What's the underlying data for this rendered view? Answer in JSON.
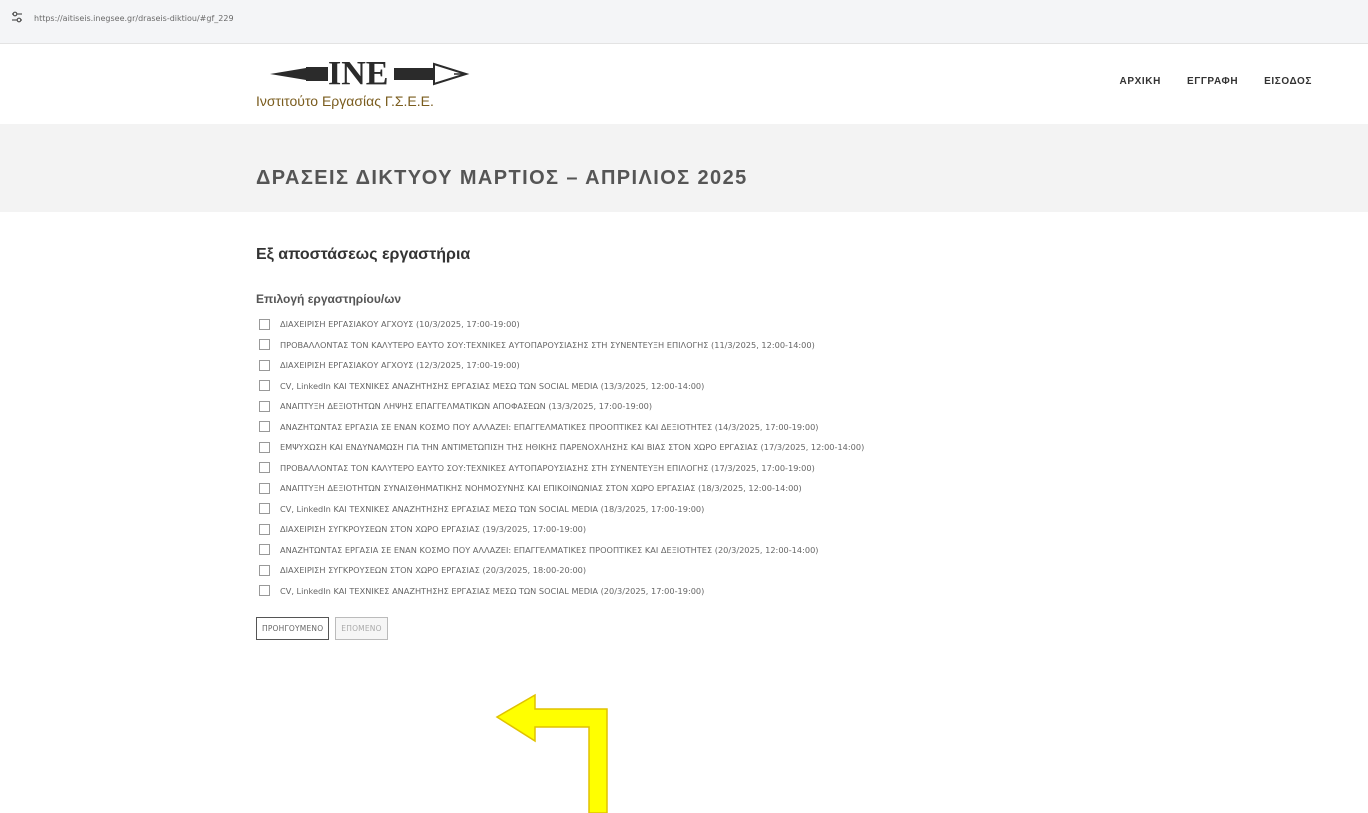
{
  "browser": {
    "url": "https://aitiseis.inegsee.gr/draseis-diktiou/#gf_229",
    "site_icon": "tune-icon"
  },
  "header": {
    "logo_text": "ΙΝΕ",
    "logo_tagline": "Ινστιτούτο Εργασίας Γ.Σ.Ε.Ε.",
    "nav": [
      {
        "label": "ΑΡΧΙΚΗ"
      },
      {
        "label": "ΕΓΓΡΑΦΗ"
      },
      {
        "label": "ΕΙΣΟΔΟΣ"
      }
    ]
  },
  "page": {
    "title": "ΔΡΑΣΕΙΣ ΔΙΚΤΥΟΥ ΜΑΡΤΙΟΣ – ΑΠΡΙΛΙΟΣ 2025"
  },
  "form": {
    "section_heading": "Εξ αποστάσεως εργαστήρια",
    "field_label": "Επιλογή εργαστηρίου/ων",
    "options": [
      {
        "label": "ΔΙΑΧΕΙΡΙΣΗ ΕΡΓΑΣΙΑΚΟΥ ΑΓΧΟΥΣ (10/3/2025, 17:00-19:00)",
        "checked": false
      },
      {
        "label": "ΠΡΟΒΑΛΛΟΝΤΑΣ ΤΟΝ ΚΑΛΥΤΕΡΟ ΕΑΥΤΟ ΣΟΥ:ΤΕΧΝΙΚΕΣ ΑΥΤΟΠΑΡΟΥΣΙΑΣΗΣ ΣΤΗ ΣΥΝΕΝΤΕΥΞΗ ΕΠΙΛΟΓΗΣ (11/3/2025, 12:00-14:00)",
        "checked": false
      },
      {
        "label": "ΔΙΑΧΕΙΡΙΣΗ ΕΡΓΑΣΙΑΚΟΥ ΑΓΧΟΥΣ (12/3/2025, 17:00-19:00)",
        "checked": false
      },
      {
        "label": "CV, LinkedIn ΚΑΙ ΤΕΧΝΙΚΕΣ ΑΝΑΖΗΤΗΣΗΣ ΕΡΓΑΣΙΑΣ ΜΕΣΩ ΤΩΝ SOCIAL MEDIA (13/3/2025, 12:00-14:00)",
        "checked": false
      },
      {
        "label": "ΑΝΑΠΤΥΞΗ ΔΕΞΙΟΤΗΤΩΝ ΛΗΨΗΣ ΕΠΑΓΓΕΛΜΑΤΙΚΩΝ ΑΠΟΦΑΣΕΩΝ (13/3/2025, 17:00-19:00)",
        "checked": false
      },
      {
        "label": "ΑΝΑΖΗΤΩΝΤΑΣ ΕΡΓΑΣΙΑ ΣΕ ΕΝΑΝ ΚΟΣΜΟ ΠΟΥ ΑΛΛΑΖΕΙ: ΕΠΑΓΓΕΛΜΑΤΙΚΕΣ ΠΡΟΟΠΤΙΚΕΣ ΚΑΙ ΔΕΞΙΟΤΗΤΕΣ (14/3/2025, 17:00-19:00)",
        "checked": false
      },
      {
        "label": "ΕΜΨΥΧΩΣΗ ΚΑΙ ΕΝΔΥΝΑΜΩΣΗ ΓΙΑ ΤΗΝ ΑΝΤΙΜΕΤΩΠΙΣΗ ΤΗΣ ΗΘΙΚΗΣ ΠΑΡΕΝΟΧΛΗΣΗΣ ΚΑΙ ΒΙΑΣ ΣΤΟΝ ΧΩΡΟ ΕΡΓΑΣΙΑΣ (17/3/2025, 12:00-14:00)",
        "checked": false
      },
      {
        "label": "ΠΡΟΒΑΛΛΟΝΤΑΣ ΤΟΝ ΚΑΛΥΤΕΡΟ ΕΑΥΤΟ ΣΟΥ:ΤΕΧΝΙΚΕΣ ΑΥΤΟΠΑΡΟΥΣΙΑΣΗΣ ΣΤΗ ΣΥΝΕΝΤΕΥΞΗ ΕΠΙΛΟΓΗΣ (17/3/2025, 17:00-19:00)",
        "checked": false
      },
      {
        "label": "ΑΝΑΠΤΥΞΗ ΔΕΞΙΟΤΗΤΩΝ ΣΥΝΑΙΣΘΗΜΑΤΙΚΗΣ ΝΟΗΜΟΣΥΝΗΣ ΚΑΙ ΕΠΙΚΟΙΝΩΝΙΑΣ ΣΤΟΝ ΧΩΡΟ ΕΡΓΑΣΙΑΣ (18/3/2025, 12:00-14:00)",
        "checked": false
      },
      {
        "label": "CV, LinkedIn ΚΑΙ ΤΕΧΝΙΚΕΣ ΑΝΑΖΗΤΗΣΗΣ ΕΡΓΑΣΙΑΣ ΜΕΣΩ ΤΩΝ SOCIAL MEDIA (18/3/2025, 17:00-19:00)",
        "checked": false
      },
      {
        "label": "ΔΙΑΧΕΙΡΙΣΗ ΣΥΓΚΡΟΥΣΕΩΝ ΣΤΟΝ ΧΩΡΟ ΕΡΓΑΣΙΑΣ (19/3/2025, 17:00-19:00)",
        "checked": false
      },
      {
        "label": "ΑΝΑΖΗΤΩΝΤΑΣ ΕΡΓΑΣΙΑ ΣΕ ΕΝΑΝ ΚΟΣΜΟ ΠΟΥ ΑΛΛΑΖΕΙ: ΕΠΑΓΓΕΛΜΑΤΙΚΕΣ ΠΡΟΟΠΤΙΚΕΣ ΚΑΙ ΔΕΞΙΟΤΗΤΕΣ (20/3/2025, 12:00-14:00)",
        "checked": false
      },
      {
        "label": "ΔΙΑΧΕΙΡΙΣΗ ΣΥΓΚΡΟΥΣΕΩΝ ΣΤΟΝ ΧΩΡΟ ΕΡΓΑΣΙΑΣ (20/3/2025, 18:00-20:00)",
        "checked": false
      },
      {
        "label": "CV, LinkedIn ΚΑΙ ΤΕΧΝΙΚΕΣ ΑΝΑΖΗΤΗΣΗΣ ΕΡΓΑΣΙΑΣ ΜΕΣΩ ΤΩΝ SOCIAL MEDIA (20/3/2025, 17:00-19:00)",
        "checked": false
      }
    ],
    "prev_label": "ΠΡΟΗΓΟΥΜΕΝΟ",
    "next_label": "ΕΠΟΜΕΝΟ",
    "next_enabled": false
  },
  "colors": {
    "arrow_fill": "#ffff00",
    "arrow_stroke": "#e0c200",
    "logo_dark": "#2b2b2b",
    "logo_gold": "#8a6a1f"
  }
}
